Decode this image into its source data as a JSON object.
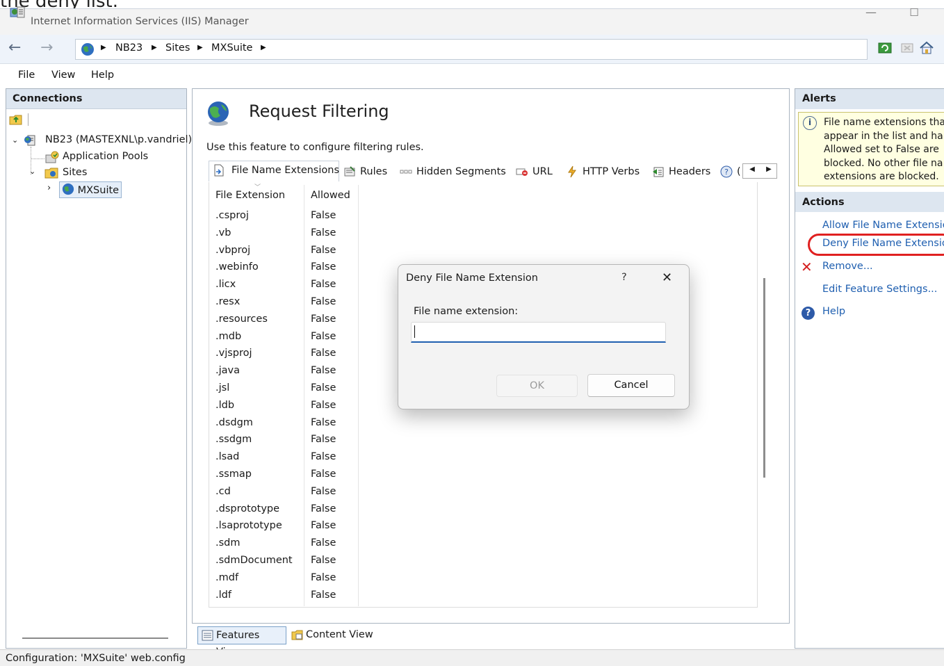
{
  "caption": "the deny list.",
  "window": {
    "title": "Internet Information Services (IIS) Manager",
    "minimize": "—",
    "maximize": "☐"
  },
  "address": {
    "crumbs": [
      "NB23",
      "Sites",
      "MXSuite"
    ],
    "separator": "▶"
  },
  "menu": {
    "file": "File",
    "view": "View",
    "help": "Help"
  },
  "connections": {
    "title": "Connections",
    "tree": {
      "server": "NB23 (MASTEXNL\\p.vandriel)",
      "app_pools": "Application Pools",
      "sites": "Sites",
      "site": "MXSuite"
    }
  },
  "feature": {
    "title": "Request Filtering",
    "description": "Use this feature to configure filtering rules."
  },
  "tabs": [
    {
      "label": "File Name Extensions",
      "icon": "file-extension-icon"
    },
    {
      "label": "Rules",
      "icon": "rules-icon"
    },
    {
      "label": "Hidden Segments",
      "icon": "hidden-segments-icon"
    },
    {
      "label": "URL",
      "icon": "url-icon"
    },
    {
      "label": "HTTP Verbs",
      "icon": "http-verbs-icon"
    },
    {
      "label": "Headers",
      "icon": "headers-icon"
    },
    {
      "label": "(",
      "icon": "query-strings-icon"
    }
  ],
  "grid": {
    "columns": [
      "File Extension",
      "Allowed"
    ],
    "rows": [
      [
        ".csproj",
        "False"
      ],
      [
        ".vb",
        "False"
      ],
      [
        ".vbproj",
        "False"
      ],
      [
        ".webinfo",
        "False"
      ],
      [
        ".licx",
        "False"
      ],
      [
        ".resx",
        "False"
      ],
      [
        ".resources",
        "False"
      ],
      [
        ".mdb",
        "False"
      ],
      [
        ".vjsproj",
        "False"
      ],
      [
        ".java",
        "False"
      ],
      [
        ".jsl",
        "False"
      ],
      [
        ".ldb",
        "False"
      ],
      [
        ".dsdgm",
        "False"
      ],
      [
        ".ssdgm",
        "False"
      ],
      [
        ".lsad",
        "False"
      ],
      [
        ".ssmap",
        "False"
      ],
      [
        ".cd",
        "False"
      ],
      [
        ".dsprototype",
        "False"
      ],
      [
        ".lsaprototype",
        "False"
      ],
      [
        ".sdm",
        "False"
      ],
      [
        ".sdmDocument",
        "False"
      ],
      [
        ".mdf",
        "False"
      ],
      [
        ".ldf",
        "False"
      ]
    ]
  },
  "views": {
    "features": "Features View",
    "content": "Content View"
  },
  "alerts": {
    "title": "Alerts",
    "text": "File name extensions tha\nappear in the list and ha\nAllowed set to False are\nblocked. No other file na\nextensions are blocked."
  },
  "actions": {
    "title": "Actions",
    "allow": "Allow File Name Extensio",
    "deny": "Deny File Name Extensio",
    "remove": "Remove...",
    "edit": "Edit Feature Settings...",
    "help": "Help"
  },
  "status": {
    "text": "Configuration: 'MXSuite' web.config"
  },
  "dialog": {
    "title": "Deny File Name Extension",
    "help": "?",
    "close": "✕",
    "field_label": "File name extension:",
    "field_value": "",
    "ok": "OK",
    "cancel": "Cancel"
  }
}
